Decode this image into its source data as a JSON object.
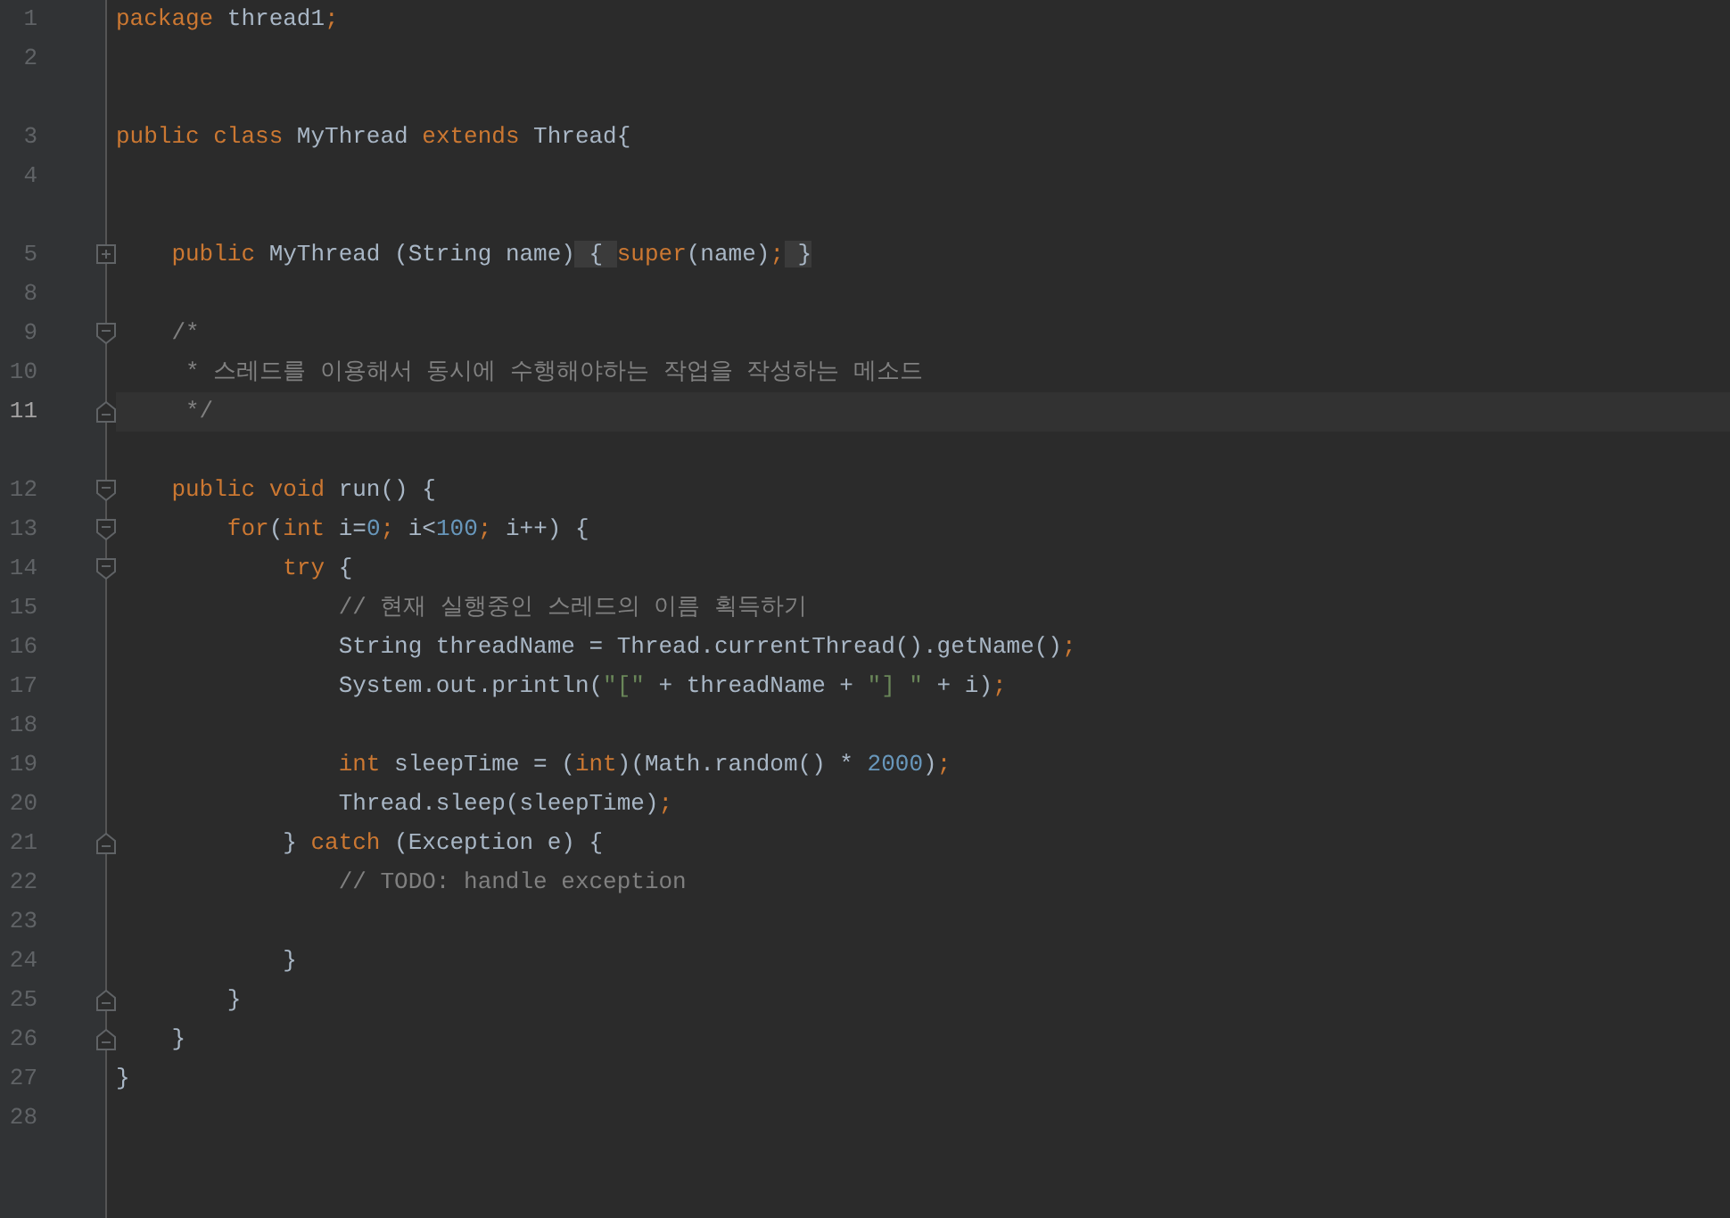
{
  "editor": {
    "lines": [
      {
        "number": "1",
        "current": false,
        "spaced": false,
        "tokens": [
          {
            "kind": "kw",
            "text": "package"
          },
          {
            "kind": "plain",
            "text": " thread1"
          },
          {
            "kind": "punct",
            "text": ";"
          }
        ]
      },
      {
        "number": "2",
        "current": false,
        "spaced": false
      },
      {
        "number": "3",
        "current": false,
        "spaced": true,
        "tokens": [
          {
            "kind": "kw",
            "text": "public class"
          },
          {
            "kind": "plain",
            "text": " MyThread "
          },
          {
            "kind": "kw",
            "text": "extends"
          },
          {
            "kind": "plain",
            "text": " Thread{"
          }
        ]
      },
      {
        "number": "4",
        "current": false,
        "spaced": false
      },
      {
        "number": "5",
        "current": false,
        "spaced": true,
        "fold": {
          "kind": "collapsed"
        },
        "tokens": [
          {
            "kind": "kw",
            "text": "    public"
          },
          {
            "kind": "plain",
            "text": " MyThread (String name)"
          },
          {
            "kind": "folded",
            "text": " { "
          },
          {
            "kind": "kw",
            "text": "super"
          },
          {
            "kind": "plain",
            "text": "(name)"
          },
          {
            "kind": "punct",
            "text": ";"
          },
          {
            "kind": "folded",
            "text": " }"
          }
        ]
      },
      {
        "number": "8",
        "current": false,
        "spaced": false
      },
      {
        "number": "9",
        "current": false,
        "spaced": false,
        "fold": {
          "kind": "start"
        },
        "tokens": [
          {
            "kind": "comment",
            "text": "    /*"
          }
        ]
      },
      {
        "number": "10",
        "current": false,
        "spaced": false,
        "tokens": [
          {
            "kind": "comment",
            "text": "     * 스레드를 이용해서 동시에 수행해야하는 작업을 작성하는 메소드"
          }
        ]
      },
      {
        "number": "11",
        "current": true,
        "spaced": false,
        "fold": {
          "kind": "end"
        },
        "tokens": [
          {
            "kind": "comment",
            "text": "     */"
          }
        ]
      },
      {
        "number": "12",
        "current": false,
        "spaced": true,
        "fold": {
          "kind": "start"
        },
        "tokens": [
          {
            "kind": "kw",
            "text": "    public void"
          },
          {
            "kind": "plain",
            "text": " run() {"
          }
        ]
      },
      {
        "number": "13",
        "current": false,
        "spaced": false,
        "fold": {
          "kind": "start"
        },
        "tokens": [
          {
            "kind": "kw",
            "text": "        for"
          },
          {
            "kind": "plain",
            "text": "("
          },
          {
            "kind": "kw",
            "text": "int"
          },
          {
            "kind": "plain",
            "text": " i="
          },
          {
            "kind": "num",
            "text": "0"
          },
          {
            "kind": "punct",
            "text": ";"
          },
          {
            "kind": "plain",
            "text": " i<"
          },
          {
            "kind": "num",
            "text": "100"
          },
          {
            "kind": "punct",
            "text": ";"
          },
          {
            "kind": "plain",
            "text": " i++) {"
          }
        ]
      },
      {
        "number": "14",
        "current": false,
        "spaced": false,
        "fold": {
          "kind": "start"
        },
        "tokens": [
          {
            "kind": "kw",
            "text": "            try"
          },
          {
            "kind": "plain",
            "text": " {"
          }
        ]
      },
      {
        "number": "15",
        "current": false,
        "spaced": false,
        "tokens": [
          {
            "kind": "comment",
            "text": "                // 현재 실행중인 스레드의 이름 획득하기"
          }
        ]
      },
      {
        "number": "16",
        "current": false,
        "spaced": false,
        "tokens": [
          {
            "kind": "plain",
            "text": "                String threadName = Thread.currentThread().getName()"
          },
          {
            "kind": "punct",
            "text": ";"
          }
        ]
      },
      {
        "number": "17",
        "current": false,
        "spaced": false,
        "tokens": [
          {
            "kind": "plain",
            "text": "                System.out.println("
          },
          {
            "kind": "str",
            "text": "\"[\""
          },
          {
            "kind": "plain",
            "text": " + threadName + "
          },
          {
            "kind": "str",
            "text": "\"] \""
          },
          {
            "kind": "plain",
            "text": " + i)"
          },
          {
            "kind": "punct",
            "text": ";"
          }
        ]
      },
      {
        "number": "18",
        "current": false,
        "spaced": false
      },
      {
        "number": "19",
        "current": false,
        "spaced": false,
        "tokens": [
          {
            "kind": "kw",
            "text": "                int"
          },
          {
            "kind": "plain",
            "text": " sleepTime = ("
          },
          {
            "kind": "kw",
            "text": "int"
          },
          {
            "kind": "plain",
            "text": ")(Math.random() * "
          },
          {
            "kind": "num",
            "text": "2000"
          },
          {
            "kind": "plain",
            "text": ")"
          },
          {
            "kind": "punct",
            "text": ";"
          }
        ]
      },
      {
        "number": "20",
        "current": false,
        "spaced": false,
        "tokens": [
          {
            "kind": "plain",
            "text": "                Thread.sleep(sleepTime)"
          },
          {
            "kind": "punct",
            "text": ";"
          }
        ]
      },
      {
        "number": "21",
        "current": false,
        "spaced": false,
        "fold": {
          "kind": "end"
        },
        "tokens": [
          {
            "kind": "plain",
            "text": "            } "
          },
          {
            "kind": "kw",
            "text": "catch"
          },
          {
            "kind": "plain",
            "text": " (Exception e) {"
          }
        ]
      },
      {
        "number": "22",
        "current": false,
        "spaced": false,
        "tokens": [
          {
            "kind": "comment",
            "text": "                // TODO: handle exception"
          }
        ]
      },
      {
        "number": "23",
        "current": false,
        "spaced": false
      },
      {
        "number": "24",
        "current": false,
        "spaced": false,
        "tokens": [
          {
            "kind": "plain",
            "text": "            }"
          }
        ]
      },
      {
        "number": "25",
        "current": false,
        "spaced": false,
        "fold": {
          "kind": "end"
        },
        "tokens": [
          {
            "kind": "plain",
            "text": "        }"
          }
        ]
      },
      {
        "number": "26",
        "current": false,
        "spaced": false,
        "fold": {
          "kind": "end"
        },
        "tokens": [
          {
            "kind": "plain",
            "text": "    }"
          }
        ]
      },
      {
        "number": "27",
        "current": false,
        "spaced": false,
        "tokens": [
          {
            "kind": "plain",
            "text": "}"
          }
        ]
      },
      {
        "number": "28",
        "current": false,
        "spaced": false
      }
    ]
  }
}
